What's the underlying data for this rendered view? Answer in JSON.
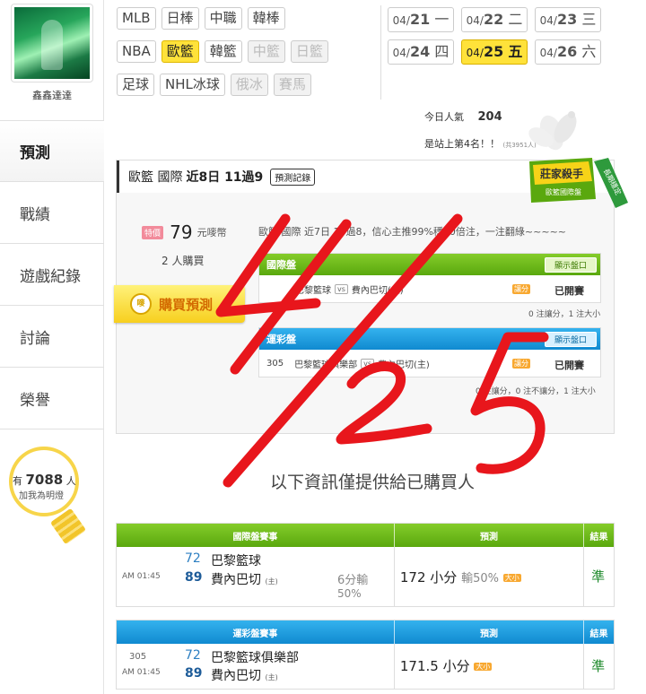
{
  "sidebar": {
    "username": "鑫鑫達達",
    "nav": [
      "預測",
      "戰績",
      "遊戲紀錄",
      "討論",
      "榮譽"
    ],
    "lamp": {
      "prefix": "有",
      "count": "7088",
      "suffix": "人",
      "caption": "加我為明燈"
    }
  },
  "sports": [
    [
      "MLB",
      "日棒",
      "中職",
      "韓棒"
    ],
    [
      "NBA",
      "歐籃",
      "韓籃",
      "中籃",
      "日籃"
    ],
    [
      "足球",
      "NHL冰球",
      "俄冰",
      "賽馬"
    ]
  ],
  "dates": [
    [
      {
        "md": "04/",
        "d": "21",
        "w": "一"
      },
      {
        "md": "04/",
        "d": "22",
        "w": "二"
      },
      {
        "md": "04/",
        "d": "23",
        "w": "三"
      }
    ],
    [
      {
        "md": "04/",
        "d": "24",
        "w": "四"
      },
      {
        "md": "04/",
        "d": "25",
        "w": "五"
      },
      {
        "md": "04/",
        "d": "26",
        "w": "六"
      }
    ]
  ],
  "stats": {
    "popularity_label": "今日人氣",
    "popularity_value": "204",
    "rank_text": "是站上第4名！！",
    "rank_small": "(共3951人)"
  },
  "card": {
    "league": "歐籃 國際",
    "record_text": "近8日 11過9",
    "record_button": "預測記錄",
    "badge_line1": "莊家殺手",
    "badge_line2": "歐籃國際盤",
    "badge_ribbon": "長期穩定",
    "price_tag": "特價",
    "price": "79",
    "price_unit": "元嘜幣",
    "buyers": "2 人購買",
    "buy_button": "購買預測",
    "buy_icon": "嘜",
    "description": "歐籃 國際 近7日 10過8，信心主推99%穩50倍注，一注翻綠~~~~~",
    "intl": {
      "title": "國際盤",
      "show_button": "顯示盤口",
      "home_team": "巴黎籃球",
      "away_team": "費內巴切(主)",
      "tag": "讓分",
      "status": "已開賽",
      "stats": "0 注讓分，1 注大小"
    },
    "sport_lottery": {
      "title": "運彩盤",
      "show_button": "顯示盤口",
      "game_no": "305",
      "home_team": "巴黎籃球俱樂部",
      "away_team": "費內巴切(主)",
      "tag": "讓分",
      "status": "已開賽",
      "stats": "0 注讓分，0 注不讓分，1 注大小"
    },
    "vs": "vs"
  },
  "info_note": "以下資訊僅提供給已購買人",
  "intl_result": {
    "headers": [
      "國際盤賽事",
      "預測",
      "結果"
    ],
    "time": "AM 01:45",
    "score_away": "72",
    "score_home": "89",
    "team_away": "巴黎籃球",
    "team_home": "費內巴切",
    "home_mark": "(主)",
    "spread_line1": "6分輸",
    "spread_line2": "50%",
    "pick": "172 小分",
    "pick_rate": "輸50%",
    "pick_tag": "大小",
    "result": "準"
  },
  "lottery_result": {
    "headers": [
      "運彩盤賽事",
      "預測",
      "結果"
    ],
    "game_no": "305",
    "time": "AM 01:45",
    "score_away": "72",
    "score_home": "89",
    "team_away": "巴黎籃球俱樂部",
    "team_home": "費內巴切",
    "home_mark": "(主)",
    "pick": "171.5 小分",
    "pick_tag": "大小",
    "result": "準"
  },
  "colors": {
    "accent_yellow": "#ffe23a",
    "green_header": "#5aa80e",
    "blue_header": "#108ad0",
    "scribble_red": "#e8161c",
    "result_green": "#1e8a2b"
  }
}
